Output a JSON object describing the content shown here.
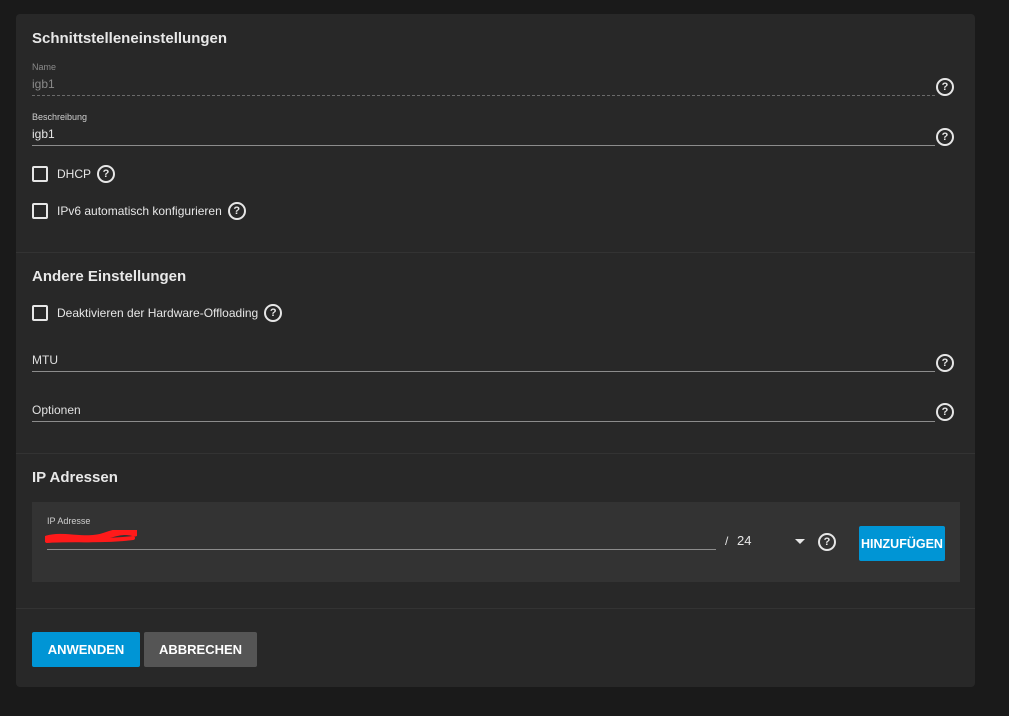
{
  "sections": {
    "interface": {
      "title": "Schnittstelleneinstellungen",
      "name_label": "Name",
      "name_value": "igb1",
      "description_label": "Beschreibung",
      "description_value": "igb1",
      "dhcp_label": "DHCP",
      "ipv6_label": "IPv6 automatisch konfigurieren"
    },
    "other": {
      "title": "Andere Einstellungen",
      "offload_label": "Deaktivieren der Hardware-Offloading",
      "mtu_placeholder": "MTU",
      "options_placeholder": "Optionen"
    },
    "ip": {
      "title": "IP Adressen",
      "address_label": "IP Adresse",
      "slash": "/",
      "netmask": "24",
      "add_button": "HINZUFÜGEN"
    }
  },
  "actions": {
    "apply": "ANWENDEN",
    "cancel": "ABBRECHEN"
  },
  "icons": {
    "help": "help-circle-icon",
    "dropdown": "caret-down-icon"
  },
  "colors": {
    "background": "#1a1a1a",
    "card": "#282828",
    "primary": "#0095d5",
    "secondary": "#555555",
    "redaction": "#ff1a1a"
  }
}
